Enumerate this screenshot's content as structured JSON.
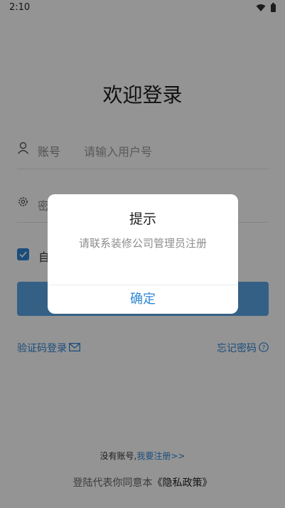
{
  "status_bar": {
    "time": "2:10",
    "icons": [
      "wifi-icon",
      "battery-icon"
    ]
  },
  "page": {
    "title": "欢迎登录"
  },
  "form": {
    "account_label": "账号",
    "account_placeholder": "请输入用户号",
    "password_label": "密",
    "remember_label": "自"
  },
  "links": {
    "sms_login": "验证码登录",
    "forgot_password": "忘记密码",
    "no_account": "没有账号,",
    "register": "我要注册>>",
    "agreement_prefix": "登陆代表你同意本",
    "privacy": "《隐私政策》"
  },
  "dialog": {
    "title": "提示",
    "message": "请联系装修公司管理员注册",
    "confirm": "确定"
  },
  "colors": {
    "accent": "#2e86d4",
    "button": "#5aa6e6",
    "overlay": "rgba(0,0,0,0.42)"
  }
}
